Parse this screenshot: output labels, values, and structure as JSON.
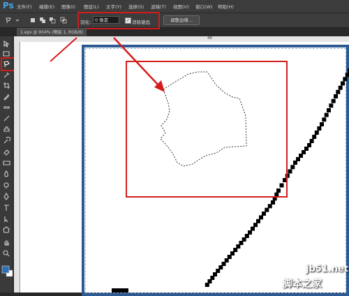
{
  "app": {
    "logo": "Ps"
  },
  "menu": [
    "文件(F)",
    "编辑(E)",
    "图像(I)",
    "图层(L)",
    "文字(Y)",
    "选择(S)",
    "滤镜(T)",
    "视图(V)",
    "窗口(W)",
    "帮助(H)"
  ],
  "options": {
    "feather_label": "羽化:",
    "feather_value": "0 像素",
    "antialias_checked": "✓",
    "antialias_label": "消除锯齿",
    "refine_edge_label": "调整边缘..."
  },
  "document": {
    "tab_title": "1.eps @ 904% (图层 1, RGB/8)",
    "ruler_mark": "40"
  },
  "toolbar": {
    "tools": [
      "move-icon",
      "marquee-icon",
      "polygonal-lasso-icon",
      "quick-select-icon",
      "crop-icon",
      "eyedropper-icon",
      "healing-icon",
      "brush-icon",
      "stamp-icon",
      "history-brush-icon",
      "eraser-icon",
      "gradient-icon",
      "blur-icon",
      "dodge-icon",
      "pen-icon",
      "type-icon",
      "path-select-icon",
      "shape-icon",
      "hand-icon",
      "zoom-icon"
    ],
    "active_tool": "polygonal-lasso-icon"
  },
  "colors": {
    "highlight": "#d31c1c",
    "frame": "#2e5a93",
    "foreground": "#2f6fb3",
    "background": "#ffffff"
  },
  "watermark": {
    "url": "jb51.net",
    "sub": "脚本之家"
  }
}
